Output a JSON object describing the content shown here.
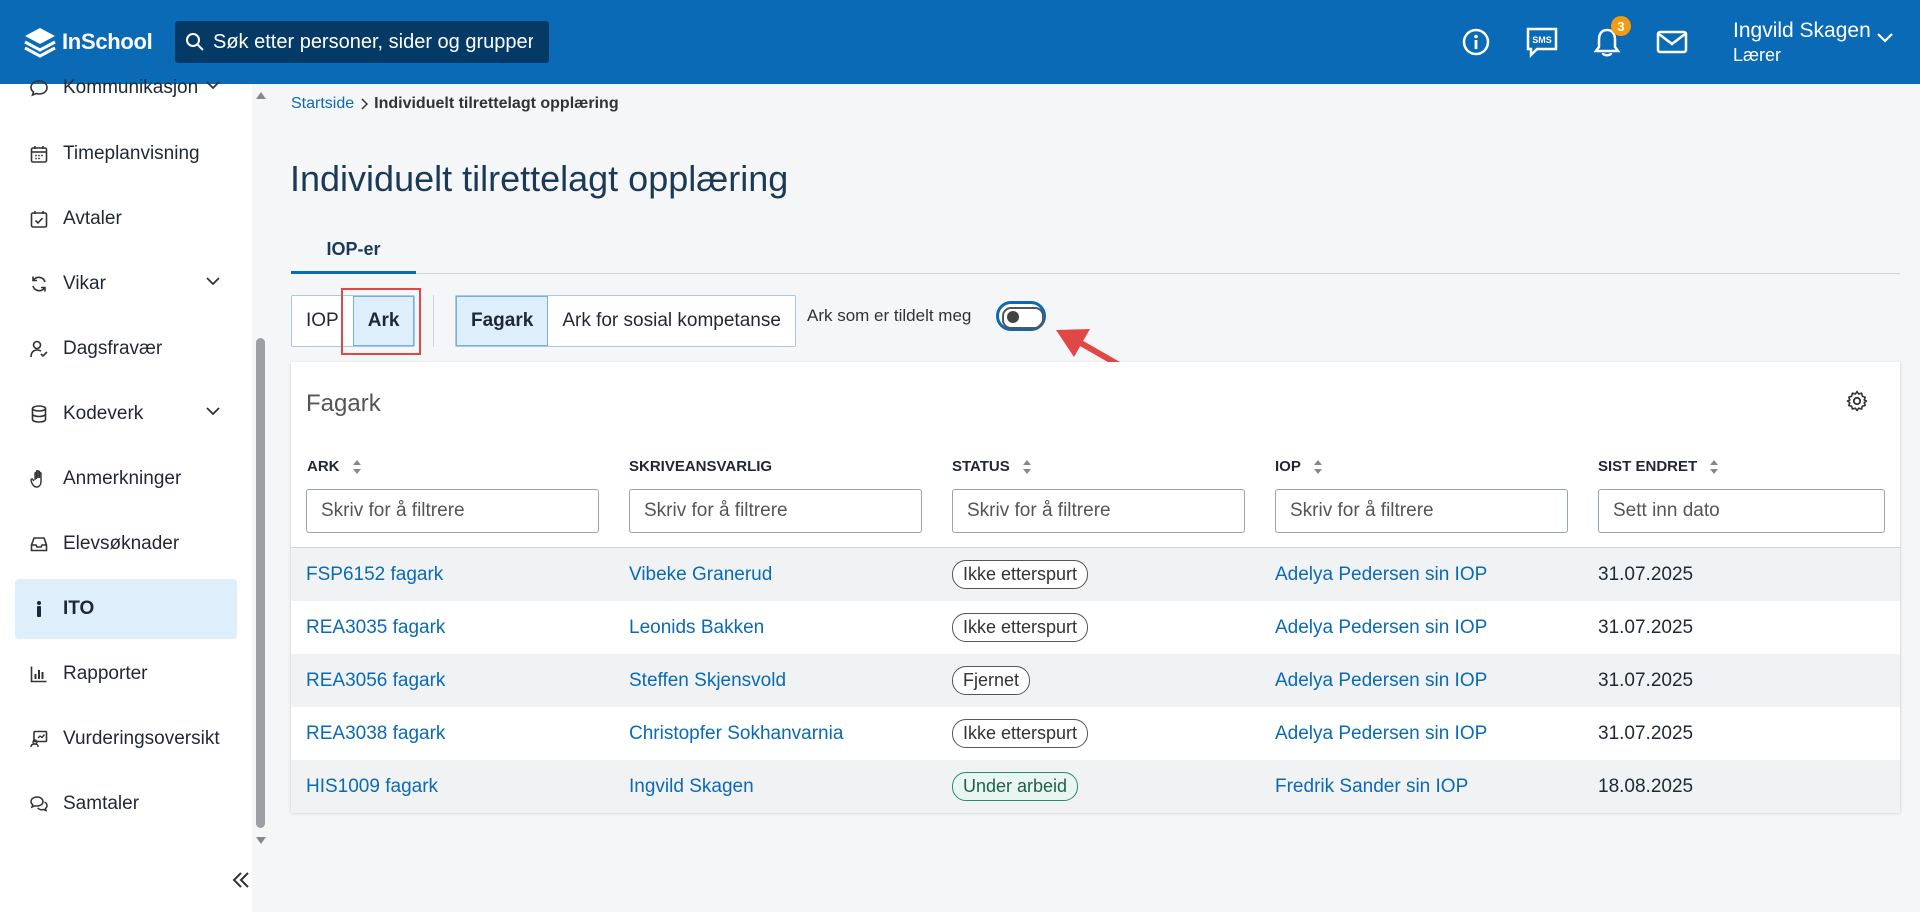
{
  "header": {
    "brand": "InSchool",
    "search_placeholder": "Søk etter personer, sider og grupper",
    "notification_count": "3",
    "user_name": "Ingvild Skagen",
    "user_role": "Lærer"
  },
  "sidebar": {
    "items": [
      {
        "label": "Kommunikasjon",
        "icon": "chat-icon"
      },
      {
        "label": "Timeplanvisning",
        "icon": "calendar-icon"
      },
      {
        "label": "Avtaler",
        "icon": "calendar-check-icon"
      },
      {
        "label": "Vikar",
        "icon": "refresh-icon"
      },
      {
        "label": "Dagsfravær",
        "icon": "user-check-icon"
      },
      {
        "label": "Kodeverk",
        "icon": "database-icon"
      },
      {
        "label": "Anmerkninger",
        "icon": "hand-icon"
      },
      {
        "label": "Elevsøknader",
        "icon": "inbox-icon"
      },
      {
        "label": "ITO",
        "icon": "person-icon"
      },
      {
        "label": "Rapporter",
        "icon": "bar-chart-icon"
      },
      {
        "label": "Vurderingsoversikt",
        "icon": "assessment-icon"
      },
      {
        "label": "Samtaler",
        "icon": "conversation-icon"
      }
    ]
  },
  "breadcrumb": {
    "home": "Startside",
    "current": "Individuelt tilrettelagt opplæring"
  },
  "page_title": "Individuelt tilrettelagt opplæring",
  "tabs": [
    {
      "label": "IOP-er"
    }
  ],
  "segment1": {
    "opt1": "IOP",
    "opt2": "Ark"
  },
  "segment2": {
    "opt1": "Fagark",
    "opt2": "Ark for sosial kompetanse"
  },
  "toggle_label": "Ark som er tildelt meg",
  "card": {
    "title": "Fagark",
    "columns": [
      "ARK",
      "SKRIVEANSVARLIG",
      "STATUS",
      "IOP",
      "SIST ENDRET"
    ],
    "filters": [
      "Skriv for å filtrere",
      "Skriv for å filtrere",
      "Skriv for å filtrere",
      "Skriv for å filtrere",
      "Sett inn dato"
    ],
    "rows": [
      {
        "ark": "FSP6152 fagark",
        "ansvarlig": "Vibeke Granerud",
        "status": "Ikke etterspurt",
        "iop": "Adelya Pedersen sin IOP",
        "endret": "31.07.2025"
      },
      {
        "ark": "REA3035 fagark",
        "ansvarlig": "Leonids Bakken",
        "status": "Ikke etterspurt",
        "iop": "Adelya Pedersen sin IOP",
        "endret": "31.07.2025"
      },
      {
        "ark": "REA3056 fagark",
        "ansvarlig": "Steffen Skjensvold",
        "status": "Fjernet",
        "iop": "Adelya Pedersen sin IOP",
        "endret": "31.07.2025"
      },
      {
        "ark": "REA3038 fagark",
        "ansvarlig": "Christopfer Sokhanvarnia",
        "status": "Ikke etterspurt",
        "iop": "Adelya Pedersen sin IOP",
        "endret": "31.07.2025"
      },
      {
        "ark": "HIS1009 fagark",
        "ansvarlig": "Ingvild Skagen",
        "status": "Under arbeid",
        "iop": "Fredrik Sander sin IOP",
        "endret": "18.08.2025"
      }
    ]
  },
  "colors": {
    "primary": "#0a6ab6",
    "header_bg": "#0a6ab6",
    "search_bg": "#063a66",
    "badge": "#f39c12",
    "annotation_red": "#e04848",
    "active_bg": "#dfeefb"
  }
}
